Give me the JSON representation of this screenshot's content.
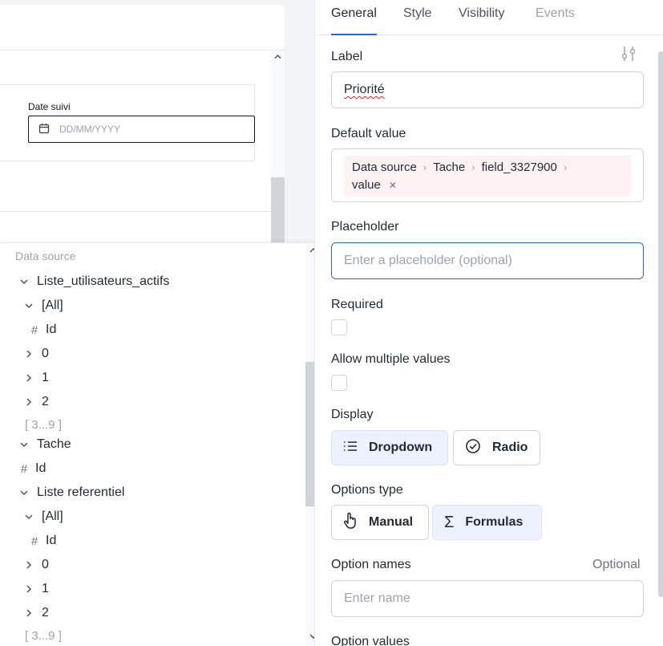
{
  "canvas": {
    "date_label": "Date suivi",
    "date_placeholder": "DD/MM/YYYY"
  },
  "tree": {
    "title": "Data source",
    "items": [
      {
        "label": "Liste_utilisateurs_actifs",
        "kind": "chevron-down"
      },
      {
        "label": "[All]",
        "kind": "chevron-down"
      },
      {
        "label": "Id",
        "kind": "hash"
      },
      {
        "label": "0",
        "kind": "chevron-right"
      },
      {
        "label": "1",
        "kind": "chevron-right"
      },
      {
        "label": "2",
        "kind": "chevron-right"
      },
      {
        "label": "[ 3...9 ]",
        "kind": "range"
      },
      {
        "label": "Tache",
        "kind": "chevron-down"
      },
      {
        "label": "Id",
        "kind": "hash"
      },
      {
        "label": "Liste referentiel",
        "kind": "chevron-down"
      },
      {
        "label": "[All]",
        "kind": "chevron-down"
      },
      {
        "label": "Id",
        "kind": "hash"
      },
      {
        "label": "0",
        "kind": "chevron-right"
      },
      {
        "label": "1",
        "kind": "chevron-right"
      },
      {
        "label": "2",
        "kind": "chevron-right"
      },
      {
        "label": "[ 3...9 ]",
        "kind": "range"
      }
    ]
  },
  "panel": {
    "tabs": {
      "general": "General",
      "style": "Style",
      "visibility": "Visibility",
      "events": "Events"
    },
    "label": {
      "title": "Label",
      "value": "Priorité"
    },
    "default_value": {
      "title": "Default value",
      "path": [
        "Data source",
        "Tache",
        "field_3327900",
        "value"
      ]
    },
    "placeholder": {
      "title": "Placeholder",
      "placeholder": "Enter a placeholder (optional)"
    },
    "required": {
      "title": "Required"
    },
    "allow_multiple": {
      "title": "Allow multiple values"
    },
    "display": {
      "title": "Display",
      "dropdown": "Dropdown",
      "radio": "Radio",
      "selected": "Dropdown"
    },
    "options_type": {
      "title": "Options type",
      "manual": "Manual",
      "formulas": "Formulas",
      "selected": "Formulas"
    },
    "option_names": {
      "title": "Option names",
      "optional": "Optional",
      "placeholder": "Enter name"
    },
    "option_values": {
      "title": "Option values"
    }
  },
  "colors": {
    "accent": "#2563eb",
    "chip_bg": "#fef2f2",
    "selected_btn_bg": "#eef2ff"
  }
}
